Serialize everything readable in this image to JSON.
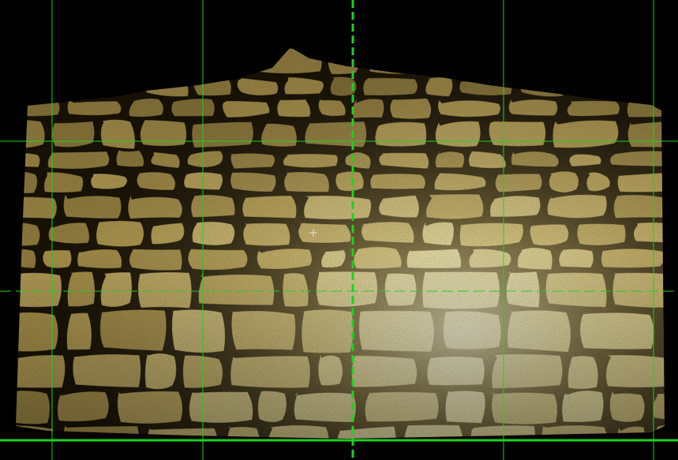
{
  "viewer": {
    "background_color": "#000000",
    "guide_color": "#1fd11f",
    "center_guide_style": "dashed",
    "cursor_icon": "crosshair-cursor-icon"
  },
  "point_cloud": {
    "subject": "stone-masonry-wall",
    "colors": {
      "stone_light": "#e9dc9a",
      "stone_mid": "#b59c52",
      "stone_dark": "#5f4f22",
      "joint": "#1b1407"
    }
  }
}
